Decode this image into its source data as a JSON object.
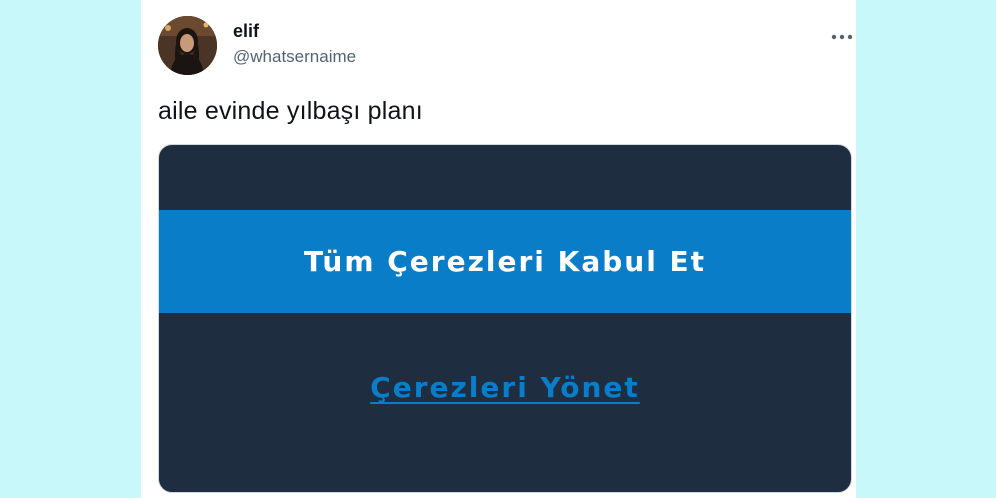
{
  "user": {
    "name": "elif",
    "handle": "@whatsernaime",
    "avatar_icon": "profile-photo"
  },
  "tweet": {
    "text": "aile evinde yılbaşı planı"
  },
  "menu": {
    "icon": "more-horizontal-icon"
  },
  "media": {
    "accept_label": "Tüm Çerezleri Kabul Et",
    "manage_label": "Çerezleri Yönet",
    "colors": {
      "panel": "#1f2d40",
      "accent": "#0a7dc8"
    }
  }
}
